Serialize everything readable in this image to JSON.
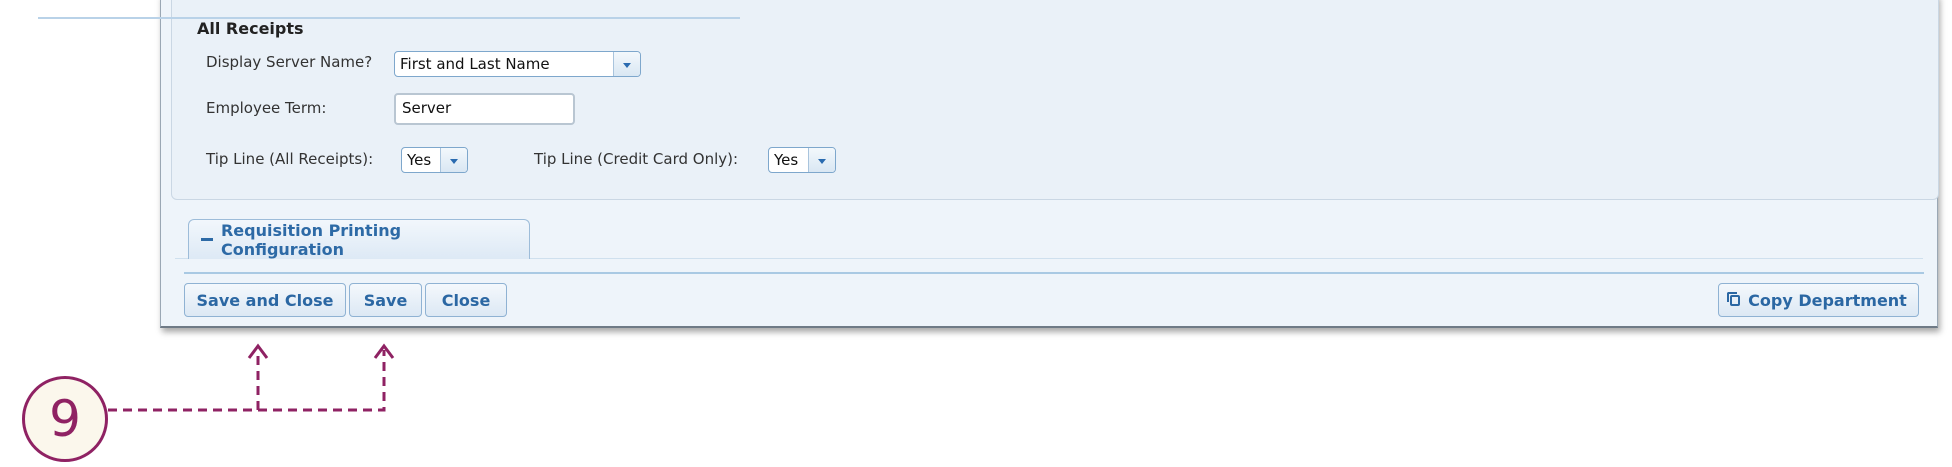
{
  "all_receipts": {
    "title": "All Receipts",
    "display_server_name_label": "Display Server Name?",
    "display_server_name_value": "First and Last Name",
    "employee_term_label": "Employee Term:",
    "employee_term_value": "Server",
    "tip_line_all_label": "Tip Line (All Receipts):",
    "tip_line_all_value": "Yes",
    "tip_line_cc_label": "Tip Line (Credit Card Only):",
    "tip_line_cc_value": "Yes"
  },
  "requisition_tab": {
    "label": "Requisition Printing Configuration",
    "icon": "minus-icon"
  },
  "toolbar": {
    "save_and_close": "Save and Close",
    "save": "Save",
    "close": "Close",
    "copy_department": "Copy Department"
  },
  "callout": {
    "number": "9",
    "color": "#8f2263"
  }
}
